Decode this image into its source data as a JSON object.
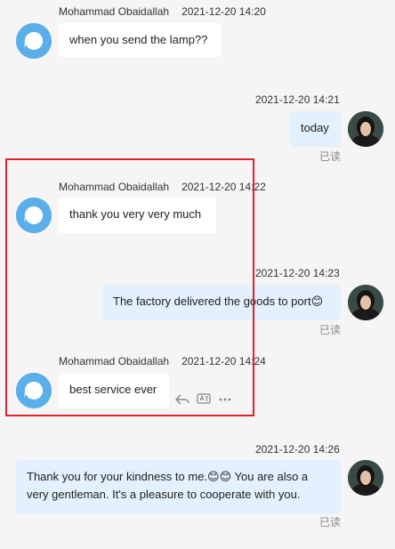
{
  "messages": [
    {
      "sender": "Mohammad Obaidallah",
      "time": "2021-12-20 14:20",
      "text": "when you send the lamp??"
    },
    {
      "time": "2021-12-20 14:21",
      "text": "today",
      "status": "已读"
    },
    {
      "sender": "Mohammad Obaidallah",
      "time": "2021-12-20 14:22",
      "text": "thank you very very much"
    },
    {
      "time": "2021-12-20 14:23",
      "text": "The factory delivered the goods to port😊",
      "status": "已读"
    },
    {
      "sender": "Mohammad Obaidallah",
      "time": "2021-12-20 14:24",
      "text": "best service ever"
    },
    {
      "time": "2021-12-20 14:26",
      "text": "Thank you for your kindness to me.😊😊 You are also a very gentleman. It's a pleasure to cooperate with you.",
      "status": "已读"
    }
  ],
  "message_actions": {
    "icons": [
      "reply-icon",
      "translate-icon",
      "more-icon"
    ]
  },
  "colors": {
    "background": "#f5f5f5",
    "incoming_bubble": "#ffffff",
    "outgoing_bubble": "#e3f0fd",
    "bot_avatar": "#5aaeea",
    "highlight": "#e0232b"
  }
}
